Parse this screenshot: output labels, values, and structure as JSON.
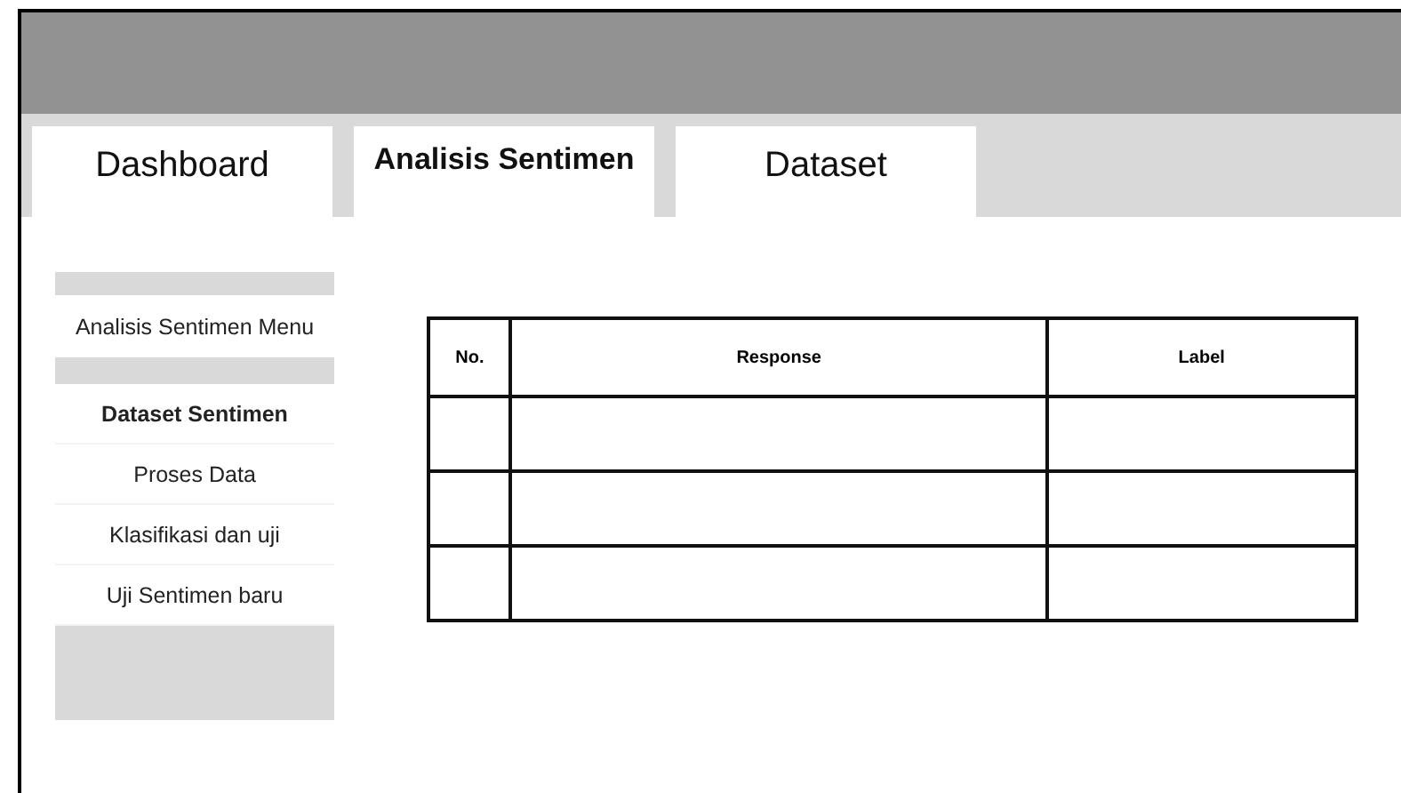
{
  "tabs": [
    {
      "label": "Dashboard",
      "selected": false
    },
    {
      "label": "Analisis Sentimen",
      "selected": true
    },
    {
      "label": "Dataset",
      "selected": false
    }
  ],
  "sidebar": {
    "title": "Analisis Sentimen Menu",
    "items": [
      {
        "label": "Dataset Sentimen",
        "selected": true
      },
      {
        "label": "Proses Data",
        "selected": false
      },
      {
        "label": "Klasifikasi dan uji",
        "selected": false
      },
      {
        "label": "Uji Sentimen baru",
        "selected": false
      }
    ]
  },
  "table": {
    "columns": [
      "No.",
      "Response",
      "Label"
    ],
    "rows": [
      {
        "kind": "blank"
      },
      {
        "kind": "blank"
      },
      {
        "kind": "blank"
      }
    ]
  }
}
